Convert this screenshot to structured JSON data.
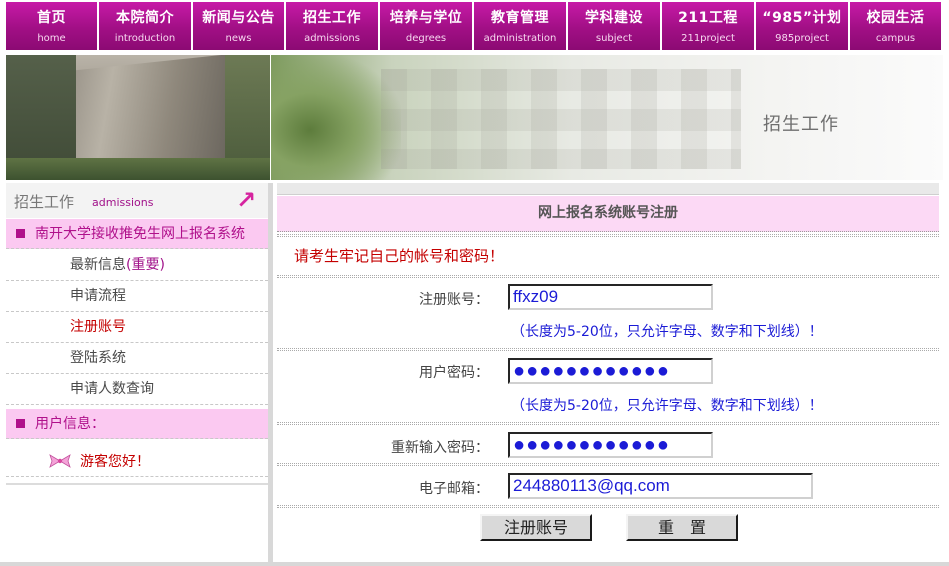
{
  "nav": [
    {
      "zh": "首页",
      "en": "home"
    },
    {
      "zh": "本院简介",
      "en": "introduction"
    },
    {
      "zh": "新闻与公告",
      "en": "news"
    },
    {
      "zh": "招生工作",
      "en": "admissions"
    },
    {
      "zh": "培养与学位",
      "en": "degrees"
    },
    {
      "zh": "教育管理",
      "en": "administration"
    },
    {
      "zh": "学科建设",
      "en": "subject"
    },
    {
      "zh": "211工程",
      "en": "211project"
    },
    {
      "zh": "“985”计划",
      "en": "985project"
    },
    {
      "zh": "校园生活",
      "en": "campus"
    }
  ],
  "banner": {
    "title": "招生工作"
  },
  "sidebar": {
    "head_zh": "招生工作",
    "head_en": "admissions",
    "arrow": "↗",
    "section1": "南开大学接收推免生网上报名系统",
    "items": [
      {
        "label": "最新信息",
        "extra": "(重要)"
      },
      {
        "label": "申请流程"
      },
      {
        "label": "注册账号"
      },
      {
        "label": "登陆系统"
      },
      {
        "label": "申请人数查询"
      }
    ],
    "section2": "用户信息：",
    "guest": "游客您好！",
    "guest_icon": "bow-icon"
  },
  "form": {
    "title": "网上报名系统账号注册",
    "notice": "请考生牢记自己的帐号和密码！",
    "account_label": "注册账号：",
    "account_value": "ffxz09",
    "account_hint": "（长度为5-20位，只允许字母、数字和下划线）！",
    "password_label": "用户密码：",
    "password_value": "●●●●●●●●●●●●",
    "password_hint": "（长度为5-20位，只允许字母、数字和下划线）！",
    "confirm_label": "重新输入密码：",
    "confirm_value": "●●●●●●●●●●●●",
    "email_label": "电子邮箱：",
    "email_value": "244880113@qq.com",
    "submit_label": "注册账号",
    "reset_label": "重　置"
  }
}
